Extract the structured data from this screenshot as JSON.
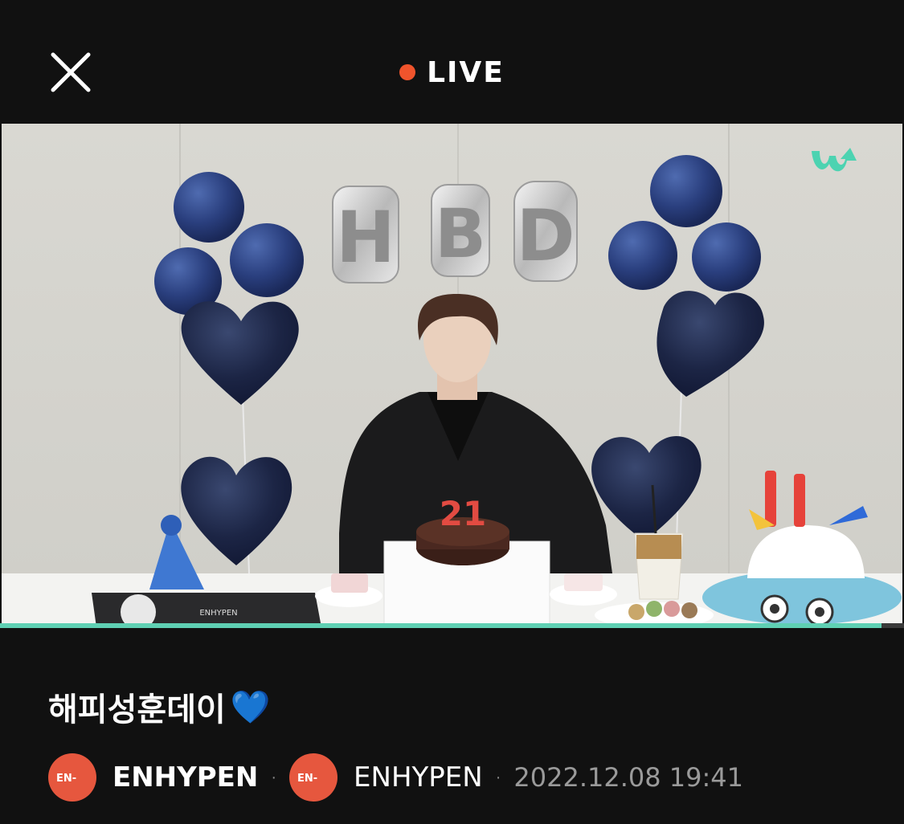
{
  "header": {
    "status_label": "LIVE",
    "live_dot_color": "#f0542c",
    "close_icon": "close-icon"
  },
  "video": {
    "balloon_letters": [
      "H",
      "B",
      "D"
    ],
    "cake_number": "21",
    "laptop_sticker_text": "ENHYPEN",
    "progress_fraction": 0.975,
    "progress_color": "#5fd0b3",
    "watermark_icon": "weverse-logo-icon"
  },
  "post": {
    "title": "해피성훈데이",
    "title_emoji": "💙",
    "channel_name": "ENHYPEN",
    "artist_name": "ENHYPEN",
    "separator": "·",
    "timestamp": "2022.12.08 19:41",
    "avatar_text": "EN-"
  },
  "colors": {
    "background": "#111111",
    "accent_live": "#f0542c",
    "avatar_bg": "#e6573e"
  }
}
